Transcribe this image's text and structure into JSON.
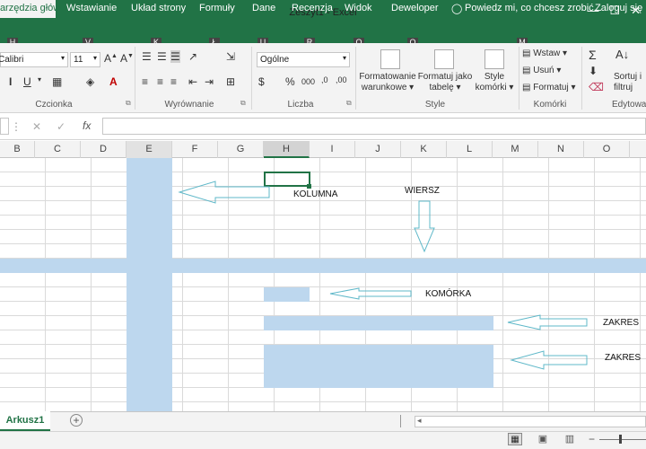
{
  "window": {
    "title": "Zeszyt1 - Excel",
    "controls": [
      "—",
      "☐",
      "✕"
    ]
  },
  "tabs": [
    {
      "label": "Narzędzia główne",
      "key": "H"
    },
    {
      "label": "Wstawianie",
      "key": "V"
    },
    {
      "label": "Układ strony",
      "key": "K"
    },
    {
      "label": "Formuły",
      "key": "Ł"
    },
    {
      "label": "Dane",
      "key": "U"
    },
    {
      "label": "Recenzja",
      "key": "R"
    },
    {
      "label": "Widok",
      "key": "O"
    },
    {
      "label": "Deweloper",
      "key": "Q"
    }
  ],
  "tell_me": "Powiedz mi, co chcesz zrobić...",
  "tell_me_key": "M",
  "login": "Zaloguj się",
  "ribbon": {
    "font_name": "Calibri",
    "font_size": "11",
    "number_format": "Ogólne",
    "groups": {
      "clipboard": "",
      "font": "Czcionka",
      "alignment": "Wyrównanie",
      "number": "Liczba",
      "styles": "Style",
      "cells": "Komórki",
      "editing": "Edytowanie"
    },
    "cond_format": [
      "Formatowanie",
      "warunkowe"
    ],
    "format_table": [
      "Formatuj jako",
      "tabelę"
    ],
    "cell_styles": [
      "Style",
      "komórki"
    ],
    "insert": "Wstaw",
    "delete": "Usuń",
    "format": "Formatuj",
    "sort": [
      "Sortuj i",
      "filtruj"
    ]
  },
  "formula_bar": {
    "fx": "fx"
  },
  "columns": [
    "B",
    "C",
    "D",
    "E",
    "F",
    "G",
    "H",
    "I",
    "J",
    "K",
    "L",
    "M",
    "N",
    "O"
  ],
  "annotations": {
    "column": "KOLUMNA",
    "row": "WIERSZ",
    "cell": "KOMÓRKA",
    "range1": "ZAKRES",
    "range2": "ZAKRES"
  },
  "sheet_tab": "Arkusz1",
  "colors": {
    "excel_green": "#217346",
    "highlight": "#bdd7ee",
    "arrow": "#5fb8c9"
  }
}
